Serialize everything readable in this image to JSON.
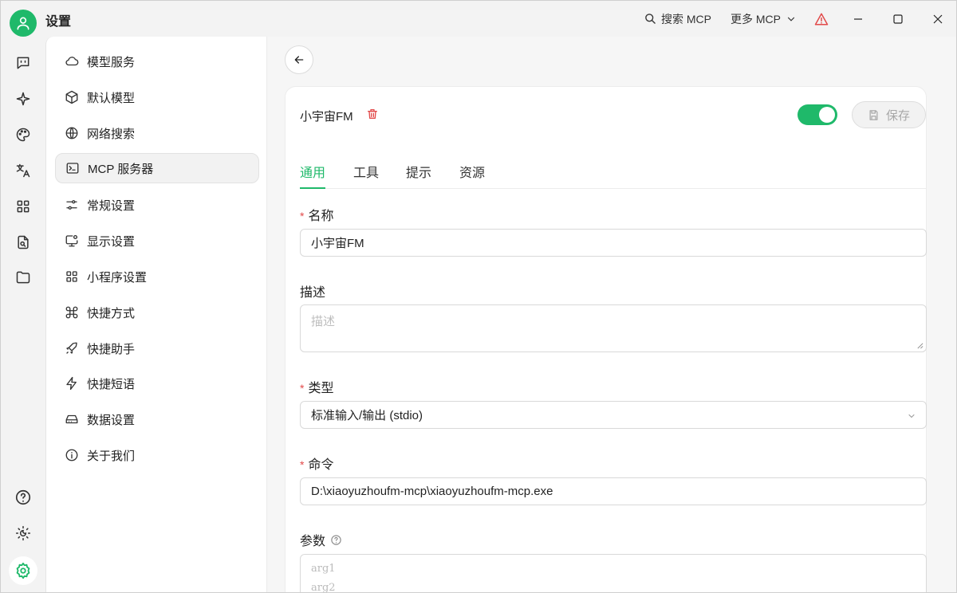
{
  "app": {
    "title": "设置"
  },
  "header": {
    "search_mcp": "搜索 MCP",
    "more_mcp": "更多 MCP"
  },
  "menu": {
    "items": [
      {
        "label": "模型服务"
      },
      {
        "label": "默认模型"
      },
      {
        "label": "网络搜索"
      },
      {
        "label": "MCP 服务器"
      },
      {
        "label": "常规设置"
      },
      {
        "label": "显示设置"
      },
      {
        "label": "小程序设置"
      },
      {
        "label": "快捷方式"
      },
      {
        "label": "快捷助手"
      },
      {
        "label": "快捷短语"
      },
      {
        "label": "数据设置"
      },
      {
        "label": "关于我们"
      }
    ],
    "active_index": 3
  },
  "server": {
    "name": "小宇宙FM",
    "save_label": "保存",
    "enabled": true
  },
  "tabs": [
    {
      "label": "通用"
    },
    {
      "label": "工具"
    },
    {
      "label": "提示"
    },
    {
      "label": "资源"
    }
  ],
  "form": {
    "name_label": "名称",
    "name_value": "小宇宙FM",
    "desc_label": "描述",
    "desc_placeholder": "描述",
    "type_label": "类型",
    "type_value": "标准输入/输出 (stdio)",
    "command_label": "命令",
    "command_value": "D:\\xiaoyuzhoufm-mcp\\xiaoyuzhoufm-mcp.exe",
    "args_label": "参数",
    "args_placeholder_line1": "arg1",
    "args_placeholder_line2": "arg2"
  },
  "colors": {
    "accent": "#1fb96a",
    "danger": "#e24a4a",
    "warning": "#e24a4a"
  }
}
